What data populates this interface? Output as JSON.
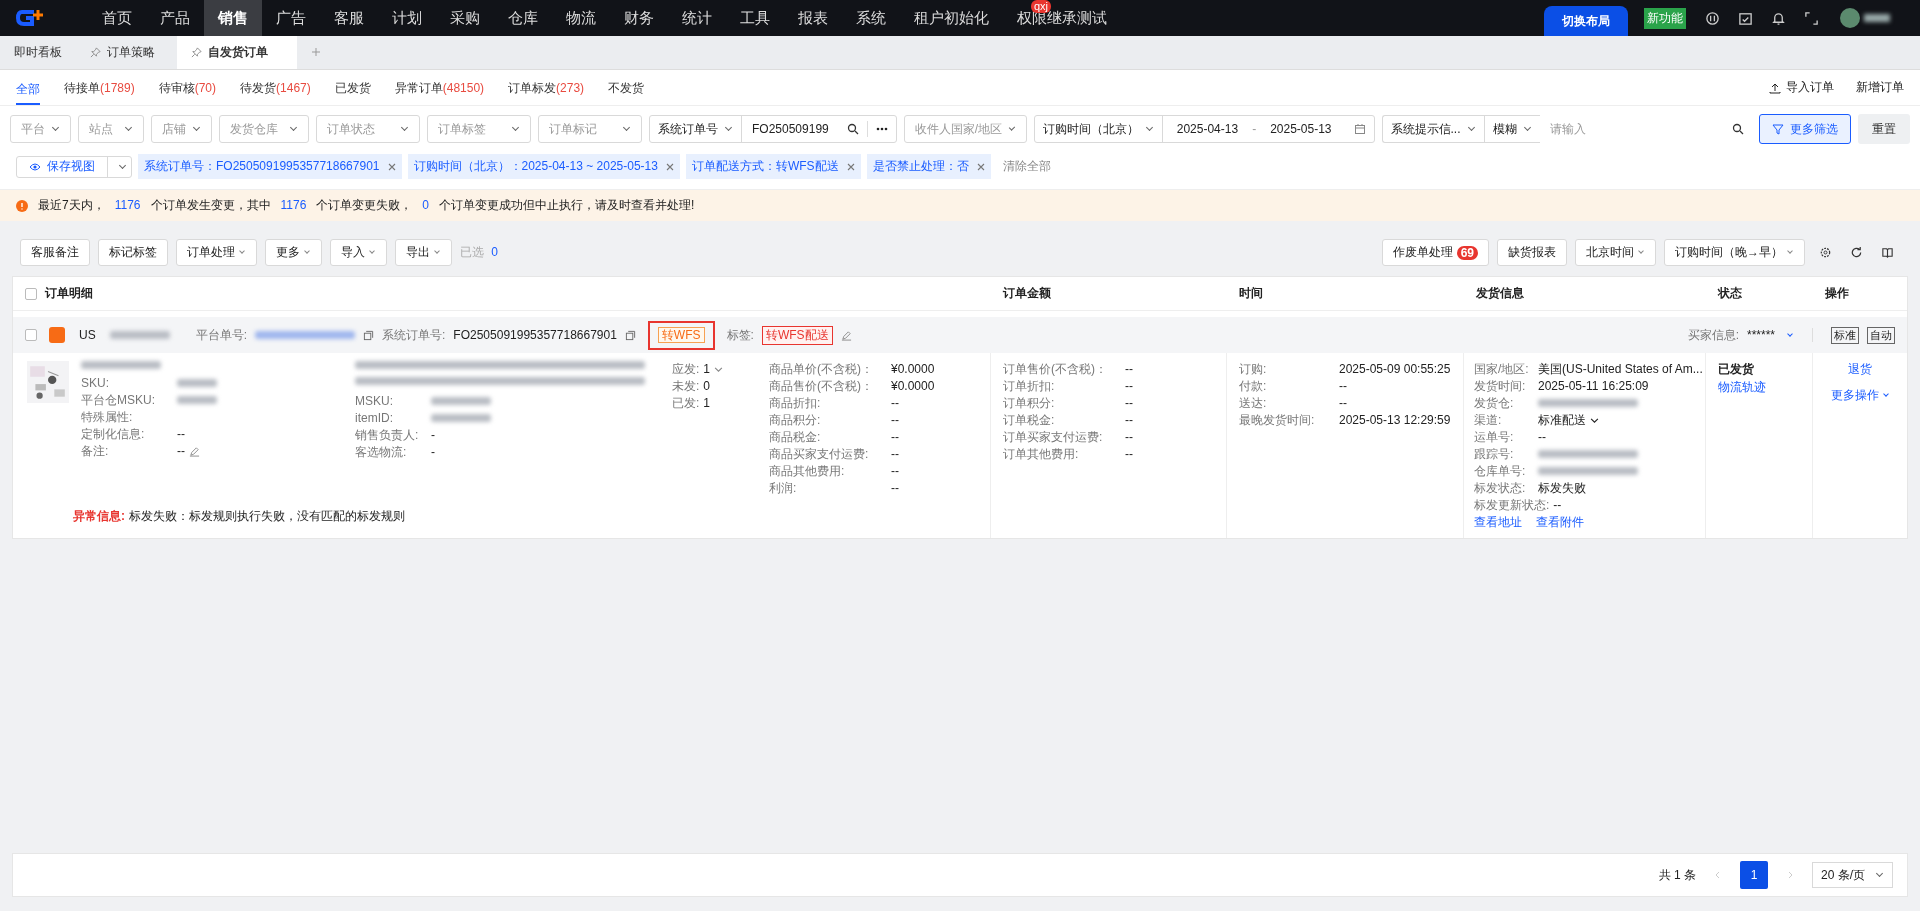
{
  "nav": {
    "items": [
      {
        "label": "首页",
        "selected": false
      },
      {
        "label": "产品",
        "selected": false
      },
      {
        "label": "销售",
        "selected": true
      },
      {
        "label": "广告",
        "selected": false
      },
      {
        "label": "客服",
        "selected": false
      },
      {
        "label": "计划",
        "selected": false
      },
      {
        "label": "采购",
        "selected": false
      },
      {
        "label": "仓库",
        "selected": false
      },
      {
        "label": "物流",
        "selected": false
      },
      {
        "label": "财务",
        "selected": false
      },
      {
        "label": "统计",
        "selected": false
      },
      {
        "label": "工具",
        "selected": false
      },
      {
        "label": "报表",
        "selected": false
      },
      {
        "label": "系统",
        "selected": false
      },
      {
        "label": "租户初始化",
        "selected": false
      },
      {
        "label": "权限继承测试",
        "selected": false,
        "badge": "qxj"
      }
    ],
    "switch_layout": "切换布局",
    "new_feature": "新功能"
  },
  "page_tabs": [
    {
      "label": "即时看板",
      "pinned": false,
      "selected": false
    },
    {
      "label": "订单策略",
      "pinned": true,
      "selected": false
    },
    {
      "label": "自发货订单",
      "pinned": true,
      "selected": true
    }
  ],
  "status_tabs": [
    {
      "label": "全部",
      "selected": true
    },
    {
      "label": "待接单",
      "count": "(1789)",
      "selected": false
    },
    {
      "label": "待审核",
      "count": "(70)",
      "selected": false
    },
    {
      "label": "待发货",
      "count": "(1467)",
      "selected": false
    },
    {
      "label": "已发货",
      "selected": false
    },
    {
      "label": "异常订单",
      "count": "(48150)",
      "selected": false
    },
    {
      "label": "订单标发",
      "count": "(273)",
      "selected": false
    },
    {
      "label": "不发货",
      "selected": false
    }
  ],
  "top_actions": [
    {
      "label": "导入订单",
      "kind": "upload"
    },
    {
      "label": "新增订单",
      "kind": "plain"
    }
  ],
  "filters": {
    "selects": [
      "平台",
      "站点",
      "店铺",
      "发货仓库",
      "订单状态",
      "订单标签",
      "订单标记"
    ],
    "search_field": "系统订单号",
    "search_value": "FO250509199",
    "country_placeholder": "收件人国家/地区",
    "date_type": "订购时间（北京）",
    "date_start": "2025-04-13",
    "date_sep": "-",
    "date_end": "2025-05-13",
    "hint_select": "系统提示信...",
    "match_mode": "模糊",
    "keyword_placeholder": "请输入",
    "more_filters": "更多筛选",
    "reset": "重置"
  },
  "chips": {
    "save_view": "保存视图",
    "items": [
      "系统订单号：FO2505091995357718667901",
      "订购时间（北京）：2025-04-13 ~ 2025-05-13",
      "订单配送方式：转WFS配送",
      "是否禁止处理：否"
    ],
    "clear": "清除全部"
  },
  "notice": [
    {
      "text": "最近7天内，",
      "kind": "plain"
    },
    {
      "text": "1176",
      "kind": "number"
    },
    {
      "text": "个订单发生变更，其中",
      "kind": "plain"
    },
    {
      "text": "1176",
      "kind": "number"
    },
    {
      "text": "个订单变更失败，",
      "kind": "plain"
    },
    {
      "text": "0",
      "kind": "number"
    },
    {
      "text": "个订单变更成功但中止执行，请及时查看并处理!",
      "kind": "plain"
    }
  ],
  "toolbar": {
    "buttons": [
      {
        "label": "客服备注",
        "dropdown": false
      },
      {
        "label": "标记标签",
        "dropdown": false
      },
      {
        "label": "订单处理",
        "dropdown": true
      },
      {
        "label": "更多",
        "dropdown": true
      },
      {
        "label": "导入",
        "dropdown": true
      },
      {
        "label": "导出",
        "dropdown": true
      }
    ],
    "selected_label": "已选",
    "selected_count": "0",
    "right": [
      {
        "label": "作废单处理",
        "badge": "69",
        "dropdown": false
      },
      {
        "label": "缺货报表",
        "dropdown": false
      },
      {
        "label": "北京时间",
        "dropdown": true
      },
      {
        "label": "订购时间（晚→早）",
        "dropdown": true
      }
    ]
  },
  "table": {
    "columns": [
      "订单明细",
      "订单金额",
      "时间",
      "发货信息",
      "状态",
      "操作"
    ],
    "header_checked": false
  },
  "order": {
    "checked": false,
    "site": "US",
    "platform_no_label": "平台单号:",
    "sys_no_label": "系统订单号:",
    "sys_no": "FO2505091995357718667901",
    "wfs_tag": "转WFS",
    "wfs_highlighted": true,
    "tag_label": "标签:",
    "tag": "转WFS配送",
    "buyer_label": "买家信息:",
    "buyer": "******",
    "flags": [
      "标准",
      "自动"
    ],
    "info": [
      {
        "label": "SKU:"
      },
      {
        "label": "平台仓MSKU:"
      },
      {
        "label": "特殊属性:"
      },
      {
        "label": "定制化信息:",
        "value": "--"
      },
      {
        "label": "备注:",
        "value": "--",
        "editable": true
      }
    ],
    "product": [
      {
        "label": "MSKU:"
      },
      {
        "label": "itemID:"
      },
      {
        "label": "销售负责人:",
        "value": "-"
      },
      {
        "label": "客选物流:",
        "value": "-"
      }
    ],
    "quantities": [
      {
        "label": "应发:",
        "value": "1",
        "dropdown": true
      },
      {
        "label": "未发:",
        "value": "0",
        "dropdown": false
      },
      {
        "label": "已发:",
        "value": "1",
        "dropdown": false
      }
    ],
    "prices": [
      {
        "label": "商品单价(不含税)：",
        "value": "¥0.0000"
      },
      {
        "label": "商品售价(不含税)：",
        "value": "¥0.0000"
      },
      {
        "label": "商品折扣:",
        "value": "--"
      },
      {
        "label": "商品积分:",
        "value": "--"
      },
      {
        "label": "商品税金:",
        "value": "--"
      },
      {
        "label": "商品买家支付运费:",
        "value": "--"
      },
      {
        "label": "商品其他费用:",
        "value": "--"
      },
      {
        "label": "利润:",
        "value": "--"
      }
    ],
    "amounts": [
      {
        "label": "订单售价(不含税)：",
        "value": "--"
      },
      {
        "label": "订单折扣:",
        "value": "--"
      },
      {
        "label": "订单积分:",
        "value": "--"
      },
      {
        "label": "订单税金:",
        "value": "--"
      },
      {
        "label": "订单买家支付运费:",
        "value": "--"
      },
      {
        "label": "订单其他费用:",
        "value": "--"
      }
    ],
    "times": [
      {
        "label": "订购:",
        "value": "2025-05-09 00:55:25"
      },
      {
        "label": "付款:",
        "value": "--"
      },
      {
        "label": "送达:",
        "value": "--"
      },
      {
        "label": "最晚发货时间:",
        "value": "2025-05-13 12:29:59"
      }
    ],
    "shipping": [
      {
        "label": "国家/地区:",
        "value": "美国(US-United States of Am..."
      },
      {
        "label": "发货时间:",
        "value": "2025-05-11 16:25:09"
      },
      {
        "label": "发货仓:"
      },
      {
        "label": "渠道:",
        "value": "标准配送",
        "dropdown": true
      },
      {
        "label": "运单号:",
        "value": "--"
      },
      {
        "label": "跟踪号:"
      },
      {
        "label": "仓库单号:"
      },
      {
        "label": "标发状态:",
        "value": "标发失败"
      },
      {
        "label": "标发更新状态:",
        "value": "--"
      }
    ],
    "shipping_links": [
      "查看地址",
      "查看附件"
    ],
    "status": "已发货",
    "status_link": "物流轨迹",
    "ops": [
      "退货",
      "更多操作"
    ],
    "error_label": "异常信息:",
    "error_text": "标发失败：标发规则执行失败，没有匹配的标发规则"
  },
  "pagination": {
    "total": "共 1 条",
    "pages": [
      {
        "label": "1",
        "selected": true
      }
    ],
    "page_size": "20 条/页"
  }
}
